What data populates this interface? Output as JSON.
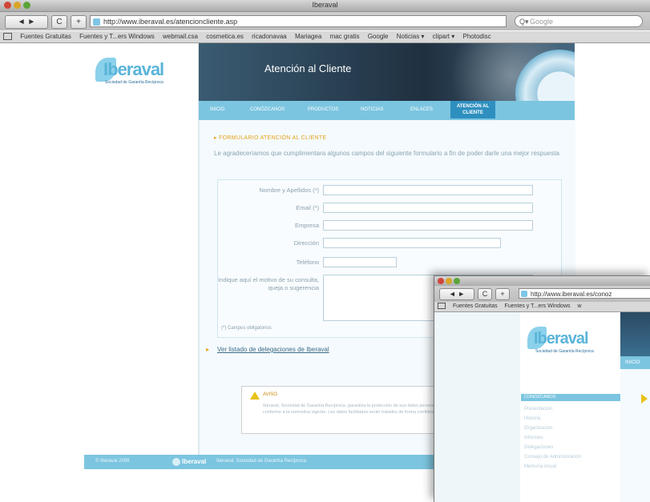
{
  "browser": {
    "title": "Iberaval",
    "url": "http://www.iberaval.es/atencioncliente.asp",
    "search_placeholder": "Google",
    "back_label": "◄ ►",
    "reload_label": "C",
    "add_label": "+",
    "bookmarks": [
      "Fuentes Gratuitas",
      "Fuentes y T...ers Windows",
      "webmail.csa",
      "cosmetica.es",
      "ricadonavaa",
      "Mariagea",
      "mac gratis",
      "Google",
      "Noticias ▾",
      "clipart ▾",
      "Photodisc"
    ]
  },
  "site": {
    "logo_text": "Iberaval",
    "logo_sub": "Sociedad de Garantía Recíproca",
    "banner_title": "Atención al Cliente",
    "nav": [
      {
        "label": "INICIO"
      },
      {
        "label": "CONÓZCANOS"
      },
      {
        "label": "PRODUCTOS"
      },
      {
        "label": "NOTICIAS"
      },
      {
        "label": "ENLACES"
      },
      {
        "label": "ATENCIÓN AL CLIENTE"
      }
    ],
    "section_title": "FORMULARIO ATENCIÓN AL CLIENTE",
    "intro_text": "Le agradeceríamos que cumplimentara algunos campos del siguiente formulario a fin de poder darle una mejor respuesta",
    "form": {
      "fields": [
        {
          "label": "Nombre y Apellidos (*)"
        },
        {
          "label": "Email (*)"
        },
        {
          "label": "Empresa"
        },
        {
          "label": "Dirección"
        },
        {
          "label": "Teléfono"
        },
        {
          "label": "Indique aquí el motivo de su consulta, queja o sugerencia"
        }
      ],
      "required_note": "(*) Campos obligatorios"
    },
    "delegaciones_link": "Ver listado de delegaciones de Iberaval",
    "notice": {
      "title": "AVISO",
      "body": "Iberaval, Sociedad de Garantía Recíproca, garantiza la protección de sus datos personales conforme a la normativa vigente. Los datos facilitados serán tratados de forma confidencial."
    },
    "footer": {
      "copyright": "© Iberaval 2008",
      "logo_text": "Iberaval",
      "text": "Iberaval, Sociedad de Garantía Recíproca"
    }
  },
  "overlay": {
    "url": "http://www.iberaval.es/conoz",
    "bookmarks": [
      "Fuentes Gratuitas",
      "Fuentes y T...ers Windows",
      "w"
    ],
    "logo_text": "Iberaval",
    "logo_sub": "Sociedad de Garantía Recíproca",
    "nav_header": "CONÓZCANOS",
    "nav_items": [
      "Presentación",
      "Historia",
      "Organización",
      "Informes",
      "Delegaciones",
      "Consejo de Administración",
      "Memoria Anual"
    ],
    "nav_strip": "INICIO"
  }
}
